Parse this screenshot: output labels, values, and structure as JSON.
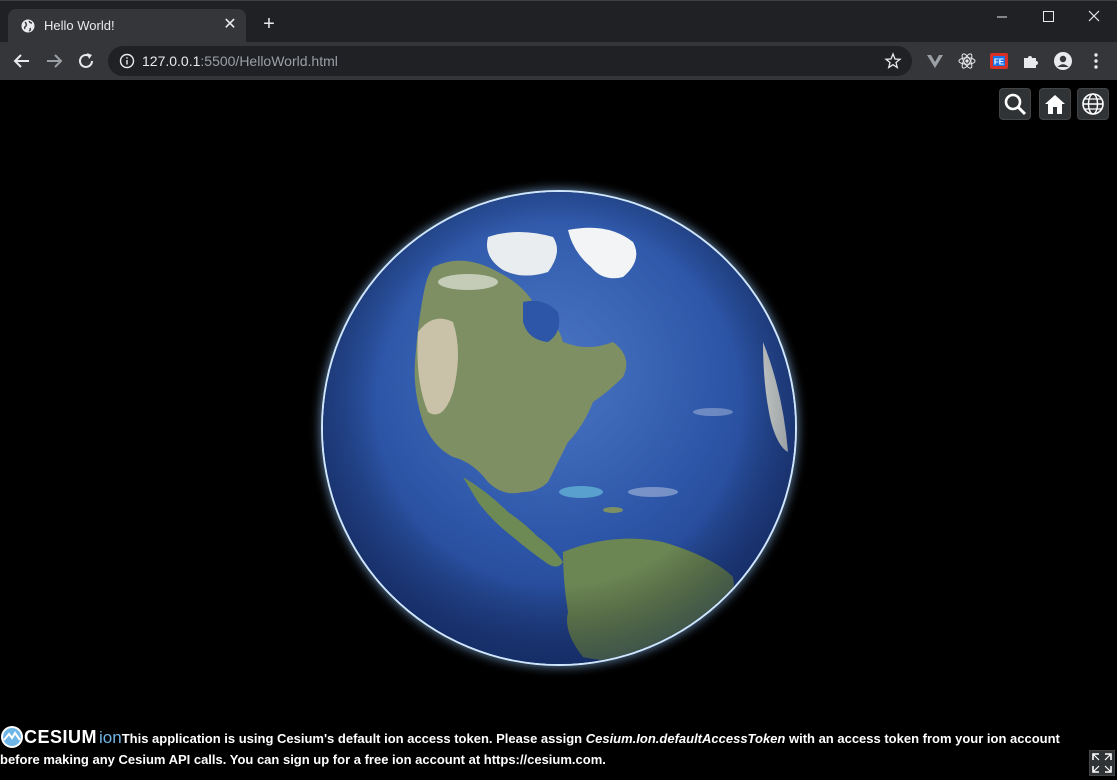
{
  "browser": {
    "tab_title": "Hello World!",
    "new_tab": "+",
    "tab_close": "✕",
    "url_host": "127.0.0.1",
    "url_rest": ":5500/HelloWorld.html"
  },
  "cesium": {
    "logo_text": "CESIUM",
    "logo_ion": "ion",
    "credit_part1": "This application is using Cesium's default ion access token. Please assign ",
    "credit_token": "Cesium.Ion.defaultAccessToken",
    "credit_part2": " with an access token from your ion account before making any Cesium API calls. You can sign up for a free ion account at ",
    "credit_link": "https://cesium.com",
    "credit_end": "."
  },
  "colors": {
    "chrome_bg": "#202124",
    "toolbar_bg": "#35363a",
    "ocean": "#2d56a8",
    "ion_accent": "#6fb6e8"
  },
  "icons": [
    "globe-favicon-icon",
    "back-icon",
    "forward-icon",
    "reload-icon",
    "info-icon",
    "star-icon",
    "search-icon",
    "home-icon",
    "globe-icon",
    "fullscreen-icon"
  ]
}
